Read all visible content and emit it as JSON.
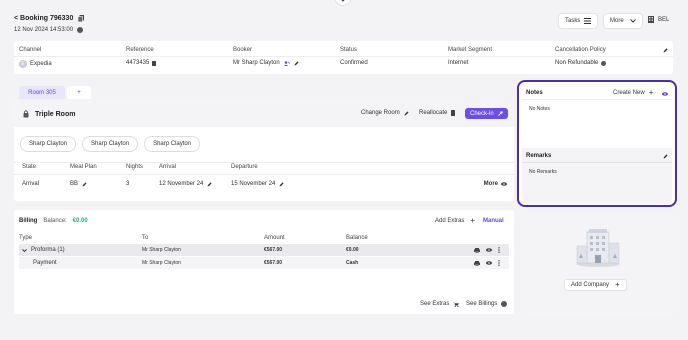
{
  "header": {
    "back_label": "< Booking 796330",
    "created": "12 Nov 2024 14:53:00",
    "tasks_label": "Tasks",
    "more_label": "More",
    "bel_label": "BEL"
  },
  "booking_table": {
    "columns": [
      "Channel",
      "Reference",
      "Booker",
      "Status",
      "Market Segment",
      "Cancellation Policy"
    ],
    "channel": "Expedia",
    "reference": "4473435",
    "booker": "Mr Sharp Clayton",
    "status": "Confirmed",
    "market_segment": "Internet",
    "cancellation_policy": "Non Refundable"
  },
  "room": {
    "tab_label": "Room 305",
    "add_tab_label": "+",
    "room_type": "Triple Room",
    "change_room_label": "Change Room",
    "reallocate_label": "Reallocate",
    "checkin_label": "Check-in",
    "guests": [
      "Sharp Clayton",
      "Sharp Clayton",
      "Sharp Clayton"
    ],
    "columns": [
      "State",
      "Meal Plan",
      "Nights",
      "Arrival",
      "Departure"
    ],
    "state": "Arrival",
    "meal_plan": "BB",
    "nights": "3",
    "arrival": "12 November 24",
    "departure": "15 November 24",
    "more_label": "More"
  },
  "billing": {
    "title": "Billing",
    "balance_label": "Balance:",
    "balance_value": "€0.00",
    "add_extras_label": "Add Extras",
    "manual_label": "Manual",
    "columns": [
      "Type",
      "To",
      "Amount",
      "Balance"
    ],
    "rows": [
      {
        "type": "Proforma (1)",
        "to": "Mr Sharp Clayton",
        "amount": "€567.00",
        "balance": "€0.00"
      },
      {
        "type": "Payment",
        "to": "Mr Sharp Clayton",
        "amount": "€567.00",
        "balance": "Cash"
      }
    ],
    "see_extras_label": "See Extras",
    "see_billings_label": "See Billings"
  },
  "notes": {
    "title": "Notes",
    "create_new_label": "Create New",
    "empty_text": "No Notes"
  },
  "remarks": {
    "title": "Remarks",
    "empty_text": "No Remarks"
  },
  "company": {
    "add_label": "Add Company"
  },
  "colors": {
    "accent": "#5c4bd6",
    "highlight_border": "#4a2fa8",
    "room_tab_bg": "#e8e6fb",
    "balance_green": "#2aa77a"
  }
}
